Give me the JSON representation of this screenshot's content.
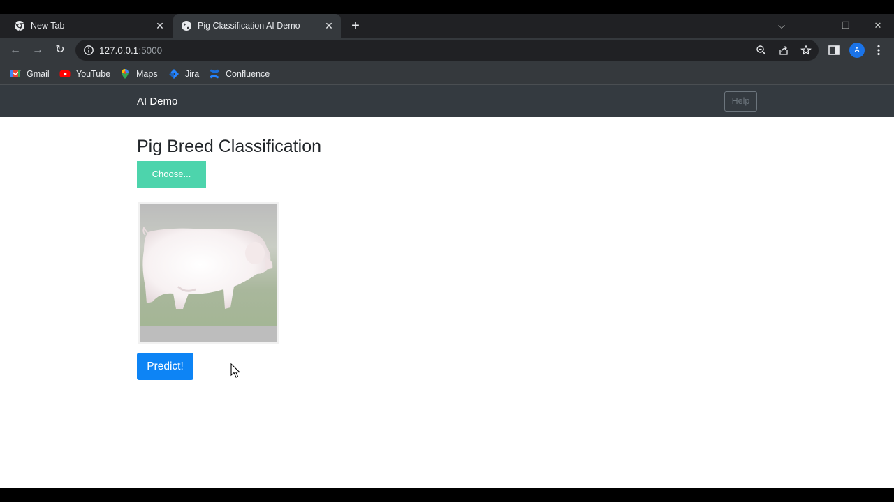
{
  "browser": {
    "tabs": [
      {
        "title": "New Tab",
        "active": false
      },
      {
        "title": "Pig Classification AI Demo",
        "active": true
      }
    ],
    "url_host": "127.0.0.1",
    "url_port": ":5000",
    "bookmarks": [
      {
        "label": "Gmail",
        "icon": "gmail-icon"
      },
      {
        "label": "YouTube",
        "icon": "youtube-icon"
      },
      {
        "label": "Maps",
        "icon": "maps-icon"
      },
      {
        "label": "Jira",
        "icon": "jira-icon"
      },
      {
        "label": "Confluence",
        "icon": "confluence-icon"
      }
    ],
    "avatar_initial": "A"
  },
  "app": {
    "brand": "AI Demo",
    "help_label": "Help",
    "heading": "Pig Breed Classification",
    "choose_label": "Choose...",
    "predict_label": "Predict!",
    "colors": {
      "navbar": "#343a40",
      "choose_button": "#4dd4ac",
      "predict_button": "#0d84f5"
    }
  }
}
